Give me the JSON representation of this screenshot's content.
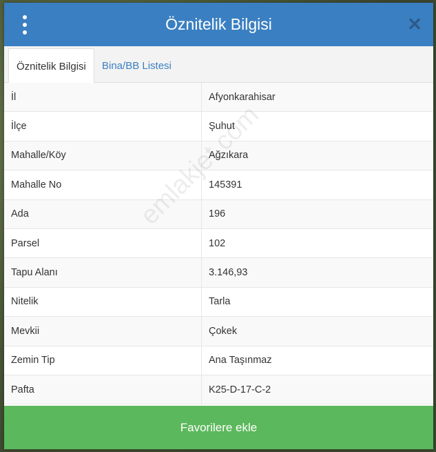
{
  "header": {
    "title": "Öznitelik Bilgisi"
  },
  "tabs": [
    {
      "label": "Öznitelik Bilgisi"
    },
    {
      "label": "Bina/BB Listesi"
    }
  ],
  "rows": [
    {
      "key": "İl",
      "value": "Afyonkarahisar"
    },
    {
      "key": "İlçe",
      "value": "Şuhut"
    },
    {
      "key": "Mahalle/Köy",
      "value": "Ağzıkara"
    },
    {
      "key": "Mahalle No",
      "value": "145391"
    },
    {
      "key": "Ada",
      "value": "196"
    },
    {
      "key": "Parsel",
      "value": "102"
    },
    {
      "key": "Tapu Alanı",
      "value": "3.146,93"
    },
    {
      "key": "Nitelik",
      "value": "Tarla"
    },
    {
      "key": "Mevkii",
      "value": "Çokek"
    },
    {
      "key": "Zemin Tip",
      "value": "Ana Taşınmaz"
    },
    {
      "key": "Pafta",
      "value": "K25-D-17-C-2"
    }
  ],
  "watermark": "emlakjet.com",
  "footer": {
    "button_label": "Favorilere ekle"
  },
  "colors": {
    "header": "#3a7fc1",
    "button": "#5cb85c"
  },
  "icons": {
    "menu": "vertical-dots-icon",
    "close": "close-icon"
  }
}
